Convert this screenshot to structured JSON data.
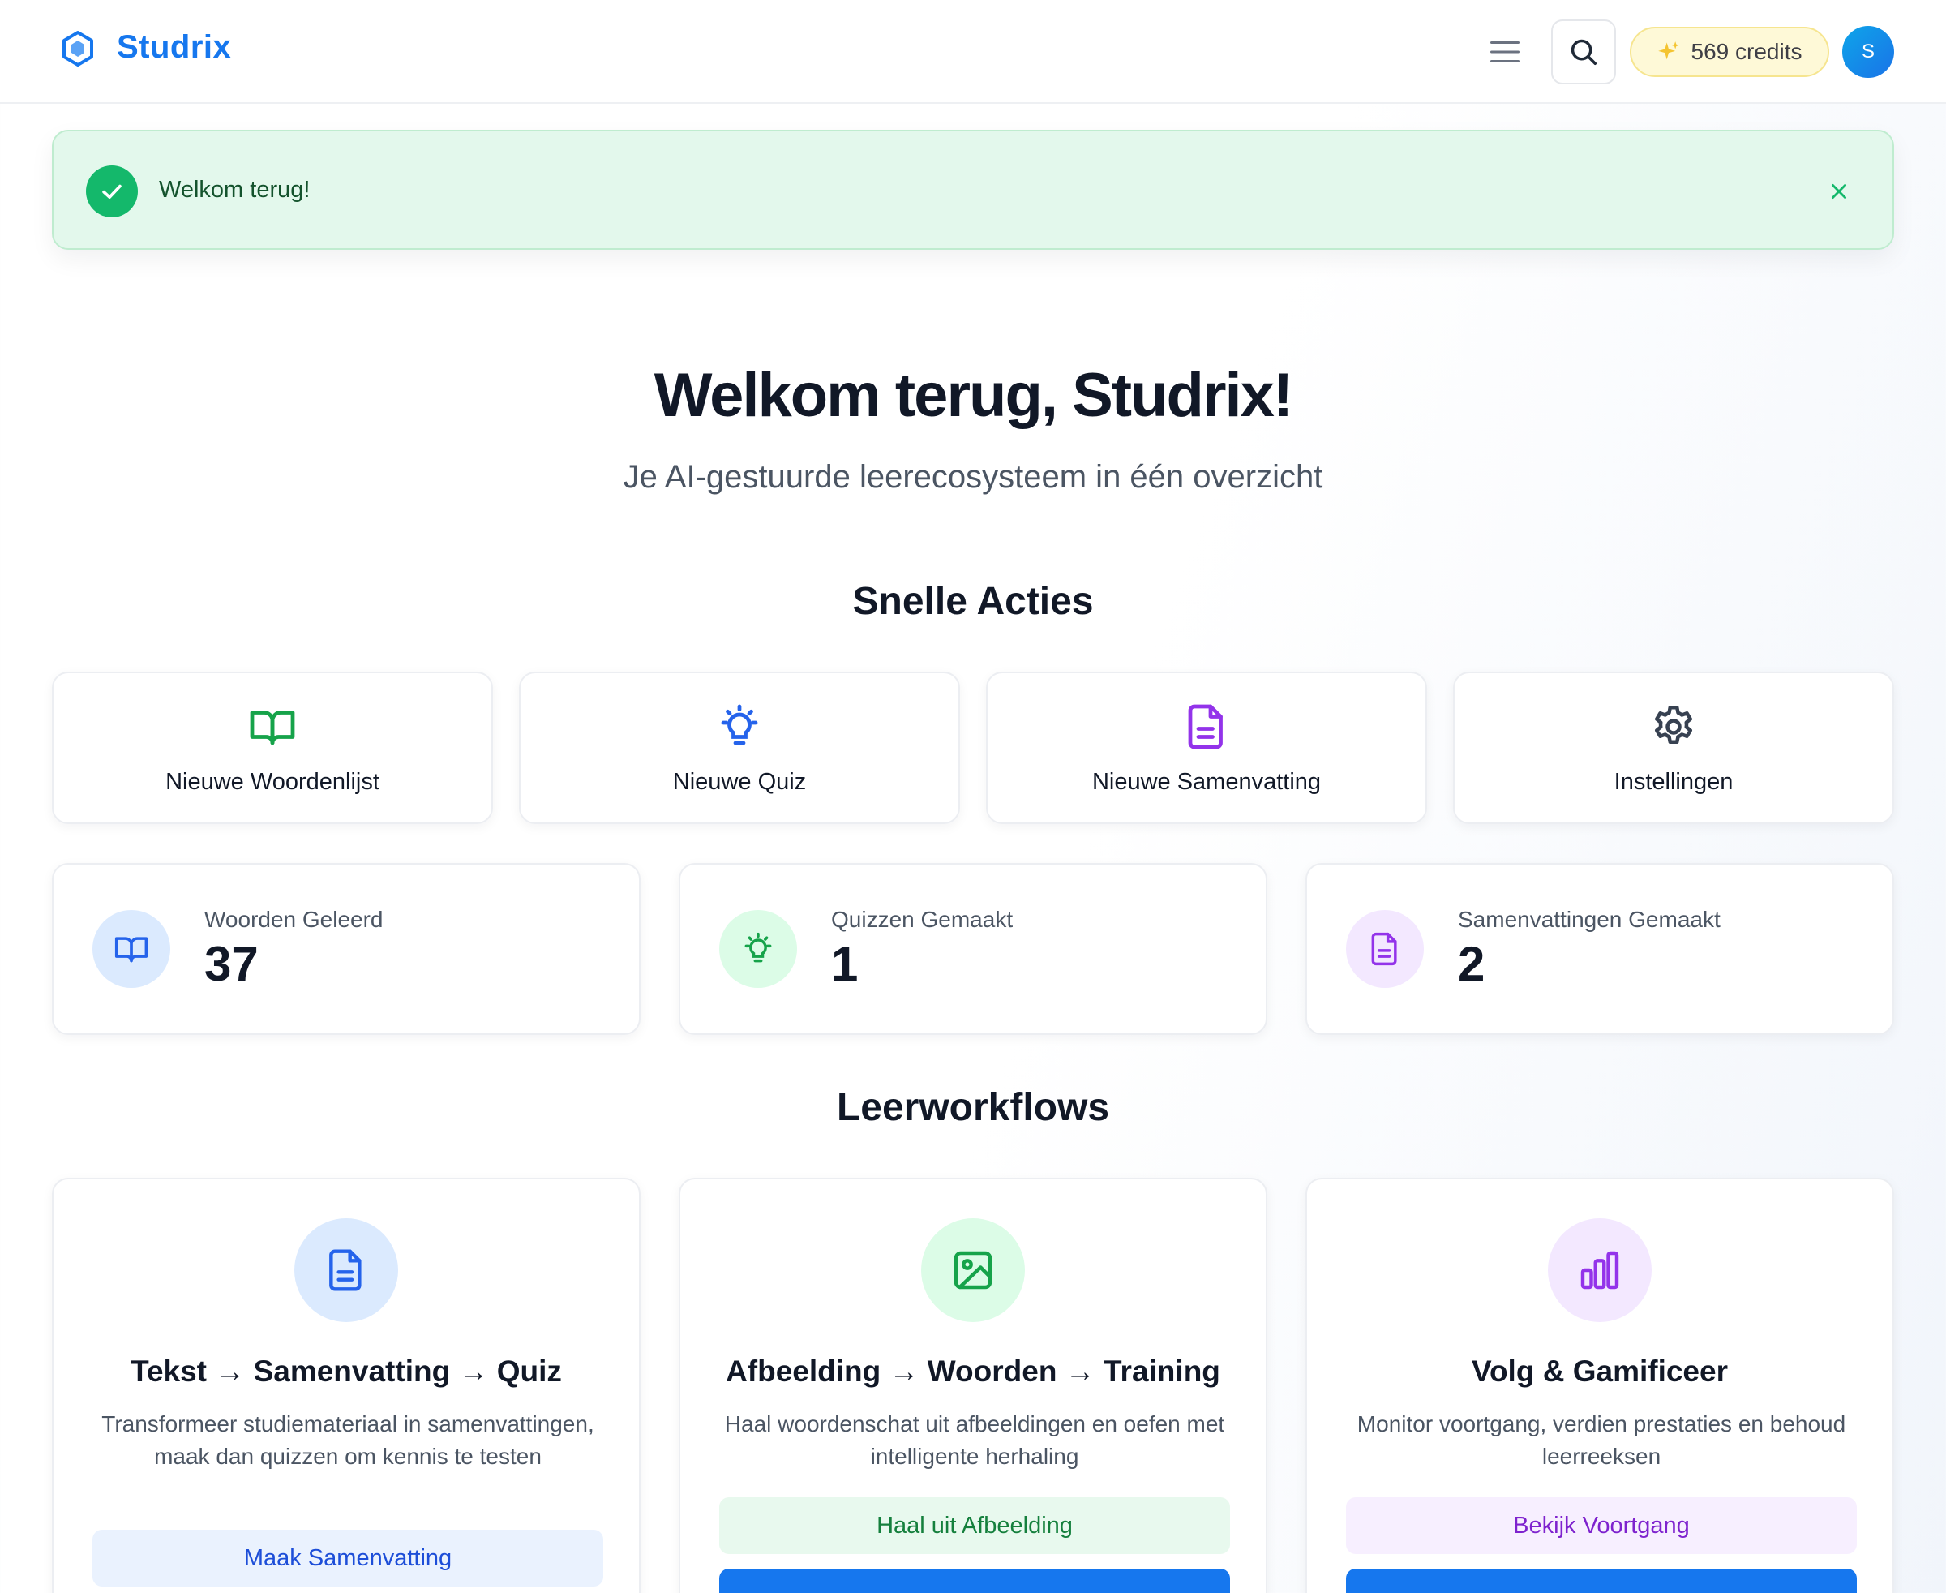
{
  "app": {
    "brand": "Studrix"
  },
  "header": {
    "credits_label": "569 credits",
    "avatar_initial": "S"
  },
  "alert": {
    "message": "Welkom terug!"
  },
  "hero": {
    "title": "Welkom terug, Studrix!",
    "subtitle": "Je AI-gestuurde leerecosysteem in één overzicht"
  },
  "quick_actions": {
    "title": "Snelle Acties",
    "items": [
      {
        "label": "Nieuwe Woordenlijst",
        "icon": "book-open-icon",
        "color": "#16a34a"
      },
      {
        "label": "Nieuwe Quiz",
        "icon": "lightbulb-icon",
        "color": "#2563eb"
      },
      {
        "label": "Nieuwe Samenvatting",
        "icon": "file-text-icon",
        "color": "#9333ea"
      },
      {
        "label": "Instellingen",
        "icon": "gear-icon",
        "color": "#374151"
      }
    ]
  },
  "stats": [
    {
      "label": "Woorden Geleerd",
      "value": "37",
      "icon": "book-open-icon",
      "bg": "#dbeafe",
      "color": "#2563eb"
    },
    {
      "label": "Quizzen Gemaakt",
      "value": "1",
      "icon": "lightbulb-icon",
      "bg": "#dcfce7",
      "color": "#16a34a"
    },
    {
      "label": "Samenvattingen Gemaakt",
      "value": "2",
      "icon": "file-text-icon",
      "bg": "#f3e8ff",
      "color": "#9333ea"
    }
  ],
  "workflows": {
    "title": "Leerworkflows",
    "items": [
      {
        "title": "Tekst → Samenvatting → Quiz",
        "description": "Transformeer studiemateriaal in samenvattingen, maak dan quizzen om kennis te testen",
        "primary_label": "Maak Samenvatting",
        "icon": "file-text-icon"
      },
      {
        "title": "Afbeelding → Woorden → Training",
        "description": "Haal woordenschat uit afbeeldingen en oefen met intelligente herhaling",
        "primary_label": "Haal uit Afbeelding",
        "icon": "image-icon"
      },
      {
        "title": "Volg & Gamificeer",
        "description": "Monitor voortgang, verdien prestaties en behoud leerreeksen",
        "primary_label": "Bekijk Voortgang",
        "icon": "bar-chart-icon"
      }
    ]
  },
  "colors": {
    "accent": "#1677ee",
    "success": "#14b86b"
  }
}
